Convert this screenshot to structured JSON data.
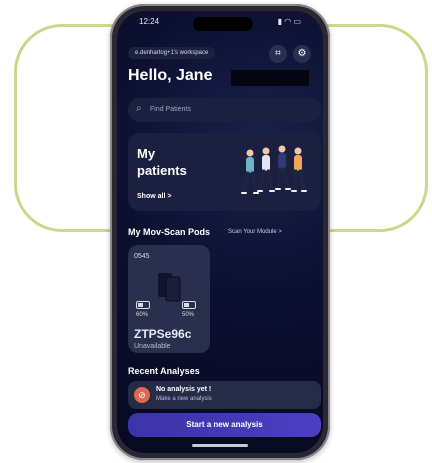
{
  "status_bar": {
    "time": "12:24",
    "icons": "▮ ◠ ▭"
  },
  "header": {
    "workspace": "e.denhartog+1's workspace",
    "qr_icon": "qr-scan-icon",
    "settings_icon": "gear-icon",
    "greeting": "Hello, Jane"
  },
  "search": {
    "placeholder": "Find Patients"
  },
  "patients_card": {
    "title": "My\npatients",
    "link": "Show all >"
  },
  "pods": {
    "title": "My Mov-Scan Pods",
    "scan_link": "Scan Your Module >",
    "items": [
      {
        "id": "0545",
        "battery_left": "60%",
        "battery_right": "50%",
        "name": "ZTPSe96c",
        "status": "Unavailable"
      }
    ]
  },
  "recent": {
    "title": "Recent Analyses",
    "empty_title": "No analysis yet !",
    "empty_subtitle": "Make a new analysis"
  },
  "cta": {
    "label": "Start a new analysis"
  },
  "colors": {
    "background": "#0c1030",
    "card": "#1b2040",
    "accent": "#4d3fc4",
    "highlight": "#c8d98a",
    "warning": "#e0694e"
  }
}
